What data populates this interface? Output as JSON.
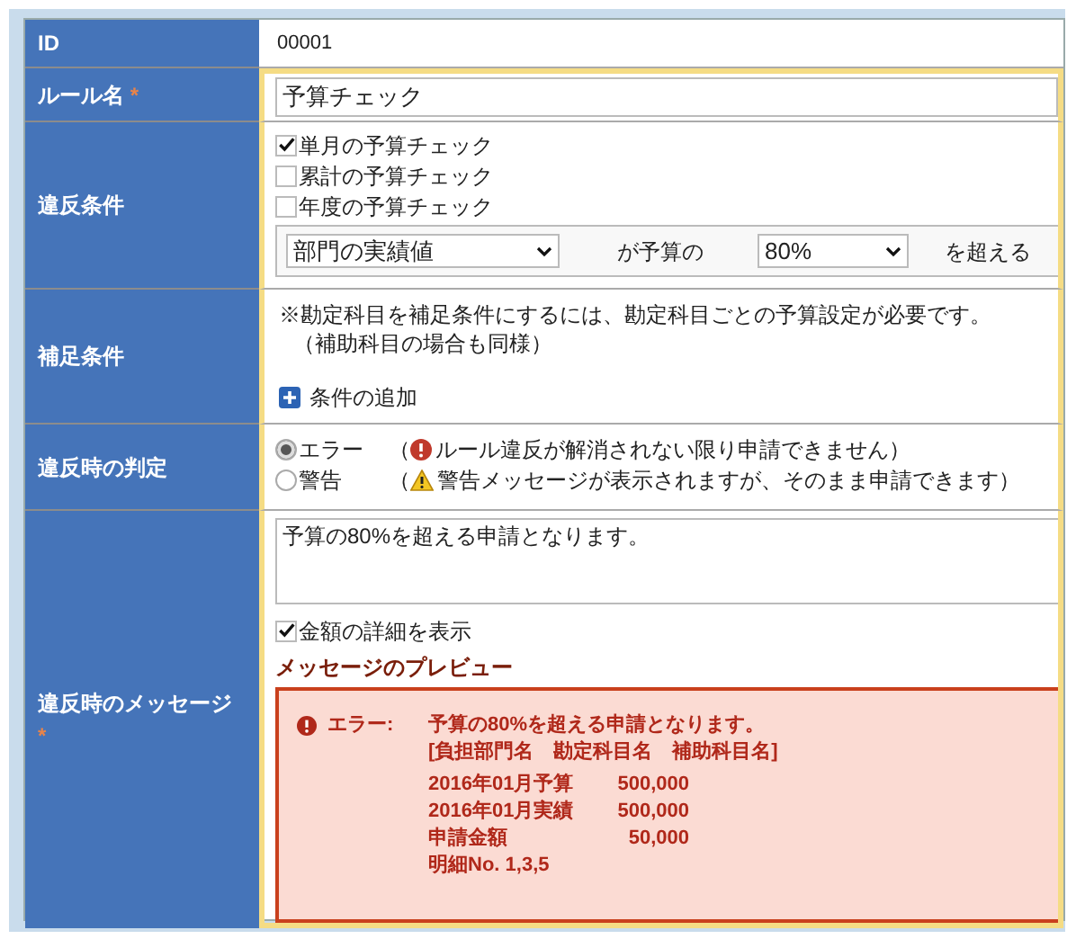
{
  "id_row": {
    "label": "ID",
    "value": "00001"
  },
  "rule_name": {
    "label": "ルール名",
    "required_mark": "*",
    "value": "予算チェック"
  },
  "violation": {
    "label": "違反条件",
    "checks": [
      {
        "label": "単月の予算チェック",
        "checked": true
      },
      {
        "label": "累計の予算チェック",
        "checked": false
      },
      {
        "label": "年度の予算チェック",
        "checked": false
      }
    ],
    "basis_select": "部門の実績値",
    "between_text": "が予算の",
    "ratio_select": "80%",
    "suffix": "を超える"
  },
  "supplement": {
    "label": "補足条件",
    "note": "※勘定科目を補足条件にするには、勘定科目ごとの予算設定が必要です。",
    "note2": "（補助科目の場合も同様）",
    "add_link": "条件の追加"
  },
  "judgment": {
    "label": "違反時の判定",
    "options": [
      {
        "label": "エラー",
        "selected": true,
        "kind": "error",
        "paren": "（",
        "note": "ルール違反が解消されない限り申請できません）"
      },
      {
        "label": "警告",
        "selected": false,
        "kind": "warning",
        "paren": "（",
        "note": "警告メッセージが表示されますが、そのまま申請できます）"
      }
    ]
  },
  "message": {
    "label": "違反時のメッセージ",
    "required_mark": "*",
    "text": "予算の80%を超える申請となります。",
    "show_details": {
      "label": "金額の詳細を表示",
      "checked": true
    },
    "preview_title": "メッセージのプレビュー",
    "preview": {
      "prefix": "エラー:",
      "message": "予算の80%を超える申請となります。",
      "header": "[負担部門名　勘定科目名　補助科目名]",
      "lines": [
        {
          "label": "2016年01月予算",
          "amount": "500,000"
        },
        {
          "label": "2016年01月実績",
          "amount": "500,000"
        },
        {
          "label": "申請金額",
          "amount": "50,000"
        }
      ],
      "detail_no": "明細No. 1,3,5"
    }
  }
}
